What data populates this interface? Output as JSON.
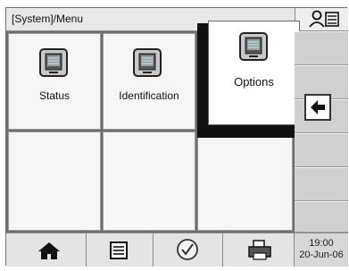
{
  "header": {
    "title": "[System]/Menu"
  },
  "icons": {
    "user": "user-list-icon",
    "back": "back-arrow-icon",
    "home": "home-icon",
    "list": "list-icon",
    "check": "check-circle-icon",
    "print": "printer-icon",
    "device": "device-icon"
  },
  "menu": {
    "tiles": [
      {
        "label": "Status"
      },
      {
        "label": "Identification"
      },
      {
        "label": "Options"
      }
    ]
  },
  "status": {
    "time": "19:00",
    "date": "20-Jun-06"
  }
}
